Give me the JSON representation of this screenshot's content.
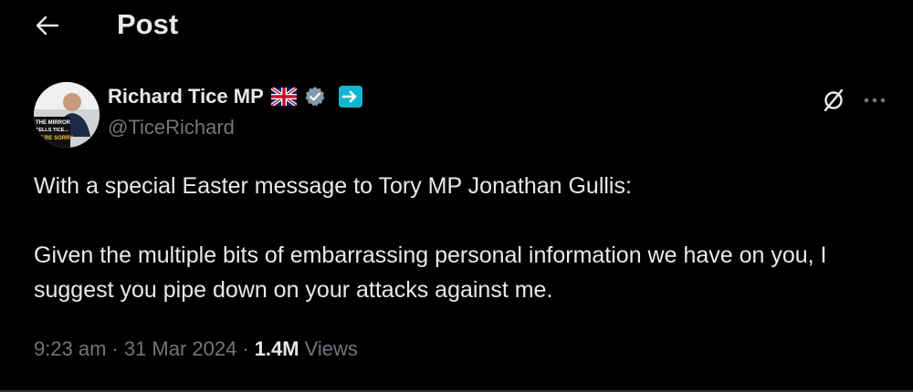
{
  "header": {
    "title": "Post"
  },
  "author": {
    "name": "Richard Tice MP",
    "handle": "@TiceRichard",
    "avatar_caption": [
      "THE MIRROR",
      "TELLS TICE...",
      "WE'RE SORRY"
    ]
  },
  "post": {
    "text": "With a special Easter message to Tory MP Jonathan Gullis:\n\nGiven the multiple bits of embarrassing personal information we have on you, I suggest you pipe down on your attacks against me.",
    "time": "9:23 am",
    "date": "31 Mar 2024",
    "views_count": "1.4M",
    "views_label": "Views"
  },
  "icons": {
    "back": "arrow-left-icon",
    "flag": "uk-flag-icon",
    "verified": "verified-badge-icon",
    "affiliate": "reform-badge-icon",
    "grok": "grok-icon",
    "more": "more-horizontal-icon"
  },
  "colors": {
    "background": "#000000",
    "text": "#e7e9ea",
    "secondary": "#71767b",
    "verified": "#829aab"
  }
}
